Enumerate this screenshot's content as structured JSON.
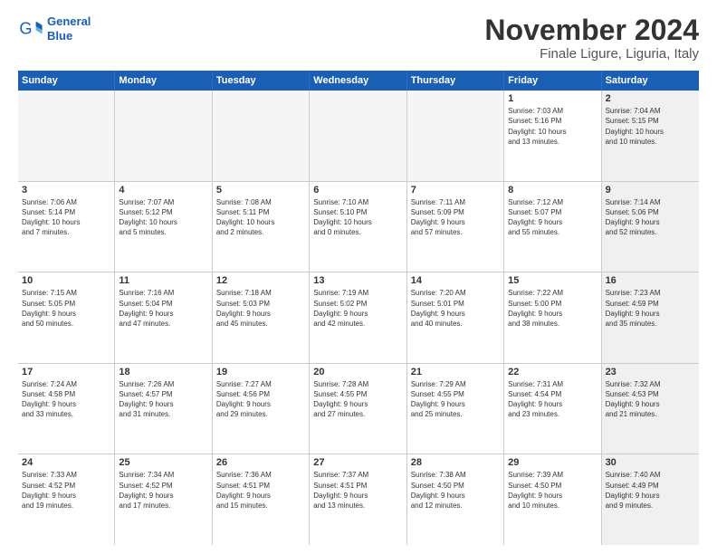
{
  "logo": {
    "line1": "General",
    "line2": "Blue",
    "icon": "🔵"
  },
  "title": "November 2024",
  "subtitle": "Finale Ligure, Liguria, Italy",
  "days_of_week": [
    "Sunday",
    "Monday",
    "Tuesday",
    "Wednesday",
    "Thursday",
    "Friday",
    "Saturday"
  ],
  "weeks": [
    [
      {
        "day": "",
        "info": "",
        "empty": true
      },
      {
        "day": "",
        "info": "",
        "empty": true
      },
      {
        "day": "",
        "info": "",
        "empty": true
      },
      {
        "day": "",
        "info": "",
        "empty": true
      },
      {
        "day": "",
        "info": "",
        "empty": true
      },
      {
        "day": "1",
        "info": "Sunrise: 7:03 AM\nSunset: 5:16 PM\nDaylight: 10 hours\nand 13 minutes."
      },
      {
        "day": "2",
        "info": "Sunrise: 7:04 AM\nSunset: 5:15 PM\nDaylight: 10 hours\nand 10 minutes.",
        "shaded": true
      }
    ],
    [
      {
        "day": "3",
        "info": "Sunrise: 7:06 AM\nSunset: 5:14 PM\nDaylight: 10 hours\nand 7 minutes."
      },
      {
        "day": "4",
        "info": "Sunrise: 7:07 AM\nSunset: 5:12 PM\nDaylight: 10 hours\nand 5 minutes."
      },
      {
        "day": "5",
        "info": "Sunrise: 7:08 AM\nSunset: 5:11 PM\nDaylight: 10 hours\nand 2 minutes."
      },
      {
        "day": "6",
        "info": "Sunrise: 7:10 AM\nSunset: 5:10 PM\nDaylight: 10 hours\nand 0 minutes."
      },
      {
        "day": "7",
        "info": "Sunrise: 7:11 AM\nSunset: 5:09 PM\nDaylight: 9 hours\nand 57 minutes."
      },
      {
        "day": "8",
        "info": "Sunrise: 7:12 AM\nSunset: 5:07 PM\nDaylight: 9 hours\nand 55 minutes."
      },
      {
        "day": "9",
        "info": "Sunrise: 7:14 AM\nSunset: 5:06 PM\nDaylight: 9 hours\nand 52 minutes.",
        "shaded": true
      }
    ],
    [
      {
        "day": "10",
        "info": "Sunrise: 7:15 AM\nSunset: 5:05 PM\nDaylight: 9 hours\nand 50 minutes."
      },
      {
        "day": "11",
        "info": "Sunrise: 7:16 AM\nSunset: 5:04 PM\nDaylight: 9 hours\nand 47 minutes."
      },
      {
        "day": "12",
        "info": "Sunrise: 7:18 AM\nSunset: 5:03 PM\nDaylight: 9 hours\nand 45 minutes."
      },
      {
        "day": "13",
        "info": "Sunrise: 7:19 AM\nSunset: 5:02 PM\nDaylight: 9 hours\nand 42 minutes."
      },
      {
        "day": "14",
        "info": "Sunrise: 7:20 AM\nSunset: 5:01 PM\nDaylight: 9 hours\nand 40 minutes."
      },
      {
        "day": "15",
        "info": "Sunrise: 7:22 AM\nSunset: 5:00 PM\nDaylight: 9 hours\nand 38 minutes."
      },
      {
        "day": "16",
        "info": "Sunrise: 7:23 AM\nSunset: 4:59 PM\nDaylight: 9 hours\nand 35 minutes.",
        "shaded": true
      }
    ],
    [
      {
        "day": "17",
        "info": "Sunrise: 7:24 AM\nSunset: 4:58 PM\nDaylight: 9 hours\nand 33 minutes."
      },
      {
        "day": "18",
        "info": "Sunrise: 7:26 AM\nSunset: 4:57 PM\nDaylight: 9 hours\nand 31 minutes."
      },
      {
        "day": "19",
        "info": "Sunrise: 7:27 AM\nSunset: 4:56 PM\nDaylight: 9 hours\nand 29 minutes."
      },
      {
        "day": "20",
        "info": "Sunrise: 7:28 AM\nSunset: 4:55 PM\nDaylight: 9 hours\nand 27 minutes."
      },
      {
        "day": "21",
        "info": "Sunrise: 7:29 AM\nSunset: 4:55 PM\nDaylight: 9 hours\nand 25 minutes."
      },
      {
        "day": "22",
        "info": "Sunrise: 7:31 AM\nSunset: 4:54 PM\nDaylight: 9 hours\nand 23 minutes."
      },
      {
        "day": "23",
        "info": "Sunrise: 7:32 AM\nSunset: 4:53 PM\nDaylight: 9 hours\nand 21 minutes.",
        "shaded": true
      }
    ],
    [
      {
        "day": "24",
        "info": "Sunrise: 7:33 AM\nSunset: 4:52 PM\nDaylight: 9 hours\nand 19 minutes."
      },
      {
        "day": "25",
        "info": "Sunrise: 7:34 AM\nSunset: 4:52 PM\nDaylight: 9 hours\nand 17 minutes."
      },
      {
        "day": "26",
        "info": "Sunrise: 7:36 AM\nSunset: 4:51 PM\nDaylight: 9 hours\nand 15 minutes."
      },
      {
        "day": "27",
        "info": "Sunrise: 7:37 AM\nSunset: 4:51 PM\nDaylight: 9 hours\nand 13 minutes."
      },
      {
        "day": "28",
        "info": "Sunrise: 7:38 AM\nSunset: 4:50 PM\nDaylight: 9 hours\nand 12 minutes."
      },
      {
        "day": "29",
        "info": "Sunrise: 7:39 AM\nSunset: 4:50 PM\nDaylight: 9 hours\nand 10 minutes."
      },
      {
        "day": "30",
        "info": "Sunrise: 7:40 AM\nSunset: 4:49 PM\nDaylight: 9 hours\nand 9 minutes.",
        "shaded": true
      }
    ]
  ]
}
